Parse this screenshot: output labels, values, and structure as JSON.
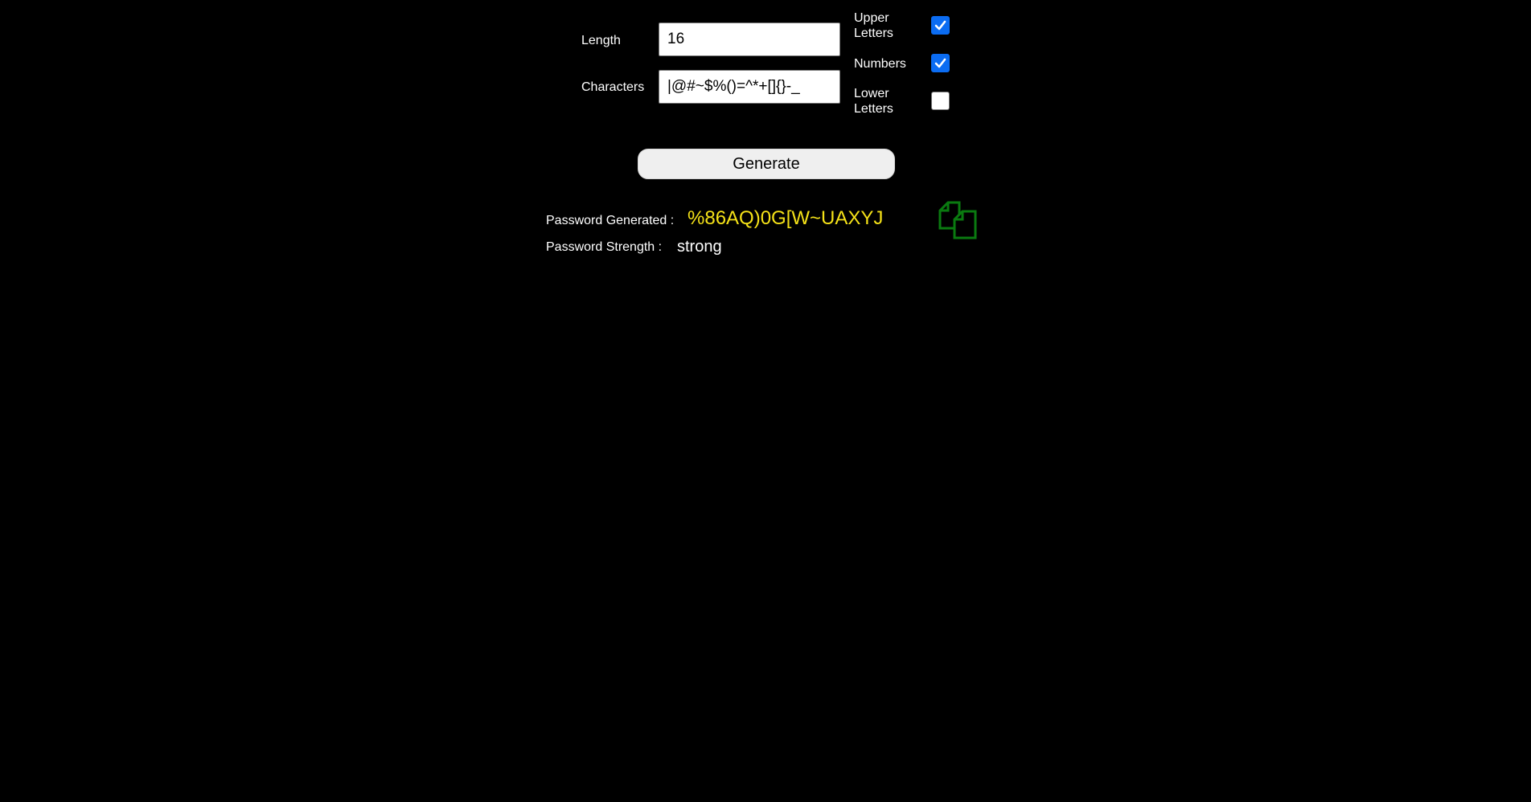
{
  "form": {
    "length_label": "Length",
    "length_value": "16",
    "characters_label": "Characters",
    "characters_value": "|@#~$%()=^*+[]{}-_",
    "upper_letters": {
      "label_line1": "Upper",
      "label_line2": "Letters",
      "checked": true
    },
    "numbers": {
      "label": "Numbers",
      "checked": true
    },
    "lower_letters": {
      "label_line1": "Lower",
      "label_line2": "Letters",
      "checked": false
    }
  },
  "generate_button_label": "Generate",
  "result": {
    "password_label": "Password Generated :",
    "password_value": "%86AQ)0G[W~UAXYJ",
    "strength_label": "Password Strength :",
    "strength_value": "strong"
  },
  "icons": {
    "copy": "copy-icon"
  },
  "colors": {
    "background": "#000000",
    "password_text": "#f5e218",
    "checkbox_accent": "#0b6cf2",
    "copy_icon": "#0a7a10"
  }
}
